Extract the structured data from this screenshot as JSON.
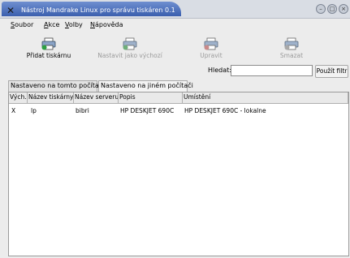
{
  "window": {
    "title": "Nástroj Mandrake Linux pro správu tiskáren 0.1"
  },
  "menu": [
    {
      "label": "Soubor",
      "accel": "S",
      "rest": "oubor"
    },
    {
      "label": "Akce",
      "accel": "A",
      "rest": "kce"
    },
    {
      "label": "Volby",
      "accel": "V",
      "rest": "olby"
    },
    {
      "label": "Nápověda",
      "accel": "N",
      "rest": "ápověda"
    }
  ],
  "toolbar": {
    "add": {
      "label": "Přidat tiskárnu",
      "icon": "printer-add-icon",
      "enabled": true
    },
    "set_default": {
      "label": "Nastavit jako výchozí",
      "icon": "printer-default-icon",
      "enabled": false
    },
    "edit": {
      "label": "Upravit",
      "icon": "printer-edit-icon",
      "enabled": false
    },
    "delete": {
      "label": "Smazat",
      "icon": "printer-delete-icon",
      "enabled": false
    }
  },
  "search": {
    "label": "Hledat:",
    "value": "",
    "button_label": "Použít filtr"
  },
  "tabs": [
    {
      "label": "Nastaveno na tomto počítači",
      "active": false
    },
    {
      "label": "Nastaveno na jiném počítači",
      "active": true
    }
  ],
  "table": {
    "columns": [
      "Vých.",
      "Název tiskárny",
      "Název serveru",
      "Popis",
      "Umístění"
    ],
    "rows": [
      [
        "X",
        "lp",
        "bibri",
        "HP DESKJET 690C",
        "HP DESKJET 690C - lokalne"
      ]
    ]
  },
  "colors": {
    "titlebar_active": "#3b5fae",
    "background": "#ececec",
    "disabled_text": "#9b9b9b"
  }
}
